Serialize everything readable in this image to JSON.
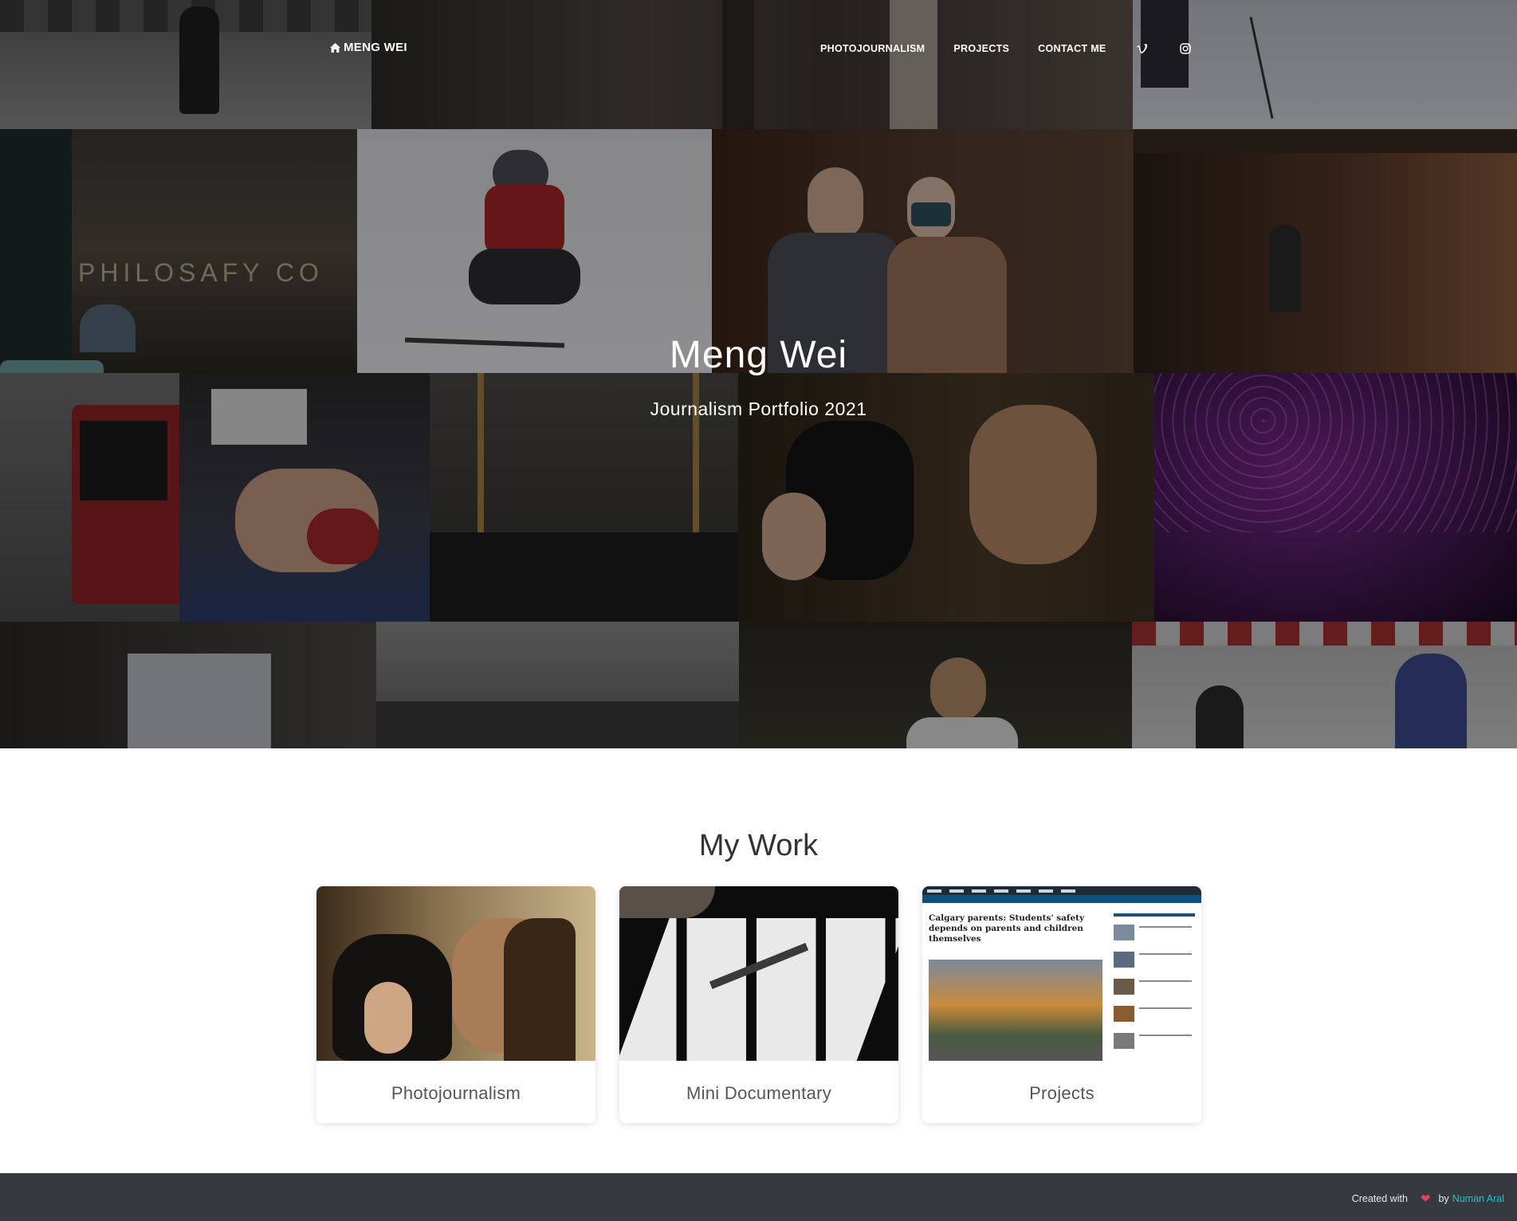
{
  "nav": {
    "brand": "MENG WEI",
    "links": [
      "PHOTOJOURNALISM",
      "PROJECTS",
      "CONTACT ME"
    ],
    "social_icons": [
      "vimeo-icon",
      "instagram-icon"
    ]
  },
  "hero": {
    "title": "Meng Wei",
    "subtitle": "Journalism Portfolio 2021",
    "overlay_text": "PHILOSAFY CO"
  },
  "work": {
    "title": "My Work",
    "cards": [
      {
        "label": "Photojournalism"
      },
      {
        "label": "Mini Documentary"
      },
      {
        "label": "Projects"
      }
    ],
    "article_preview": {
      "headline": "Calgary parents: Students' safety depends on parents and children themselves"
    }
  },
  "footer": {
    "created_with": "Created with",
    "by": "by",
    "author": "Numan Aral"
  },
  "colors": {
    "footer_bg": "#343a40",
    "footer_link": "#36b5c9",
    "heart": "#e83e5c"
  }
}
